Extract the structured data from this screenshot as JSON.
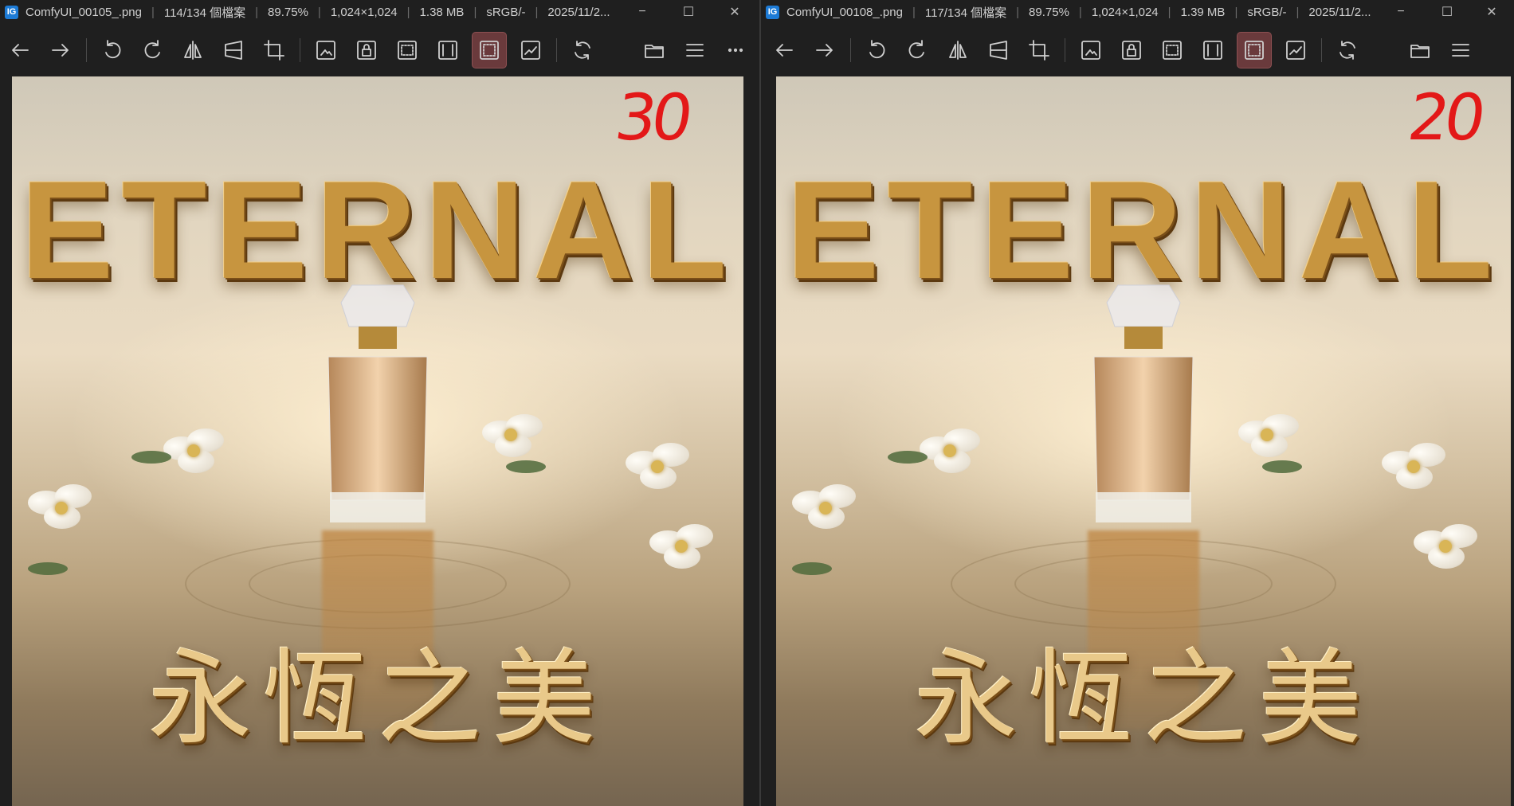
{
  "left": {
    "title": {
      "filename": "ComfyUI_00105_.png",
      "index": "114/134 個檔案",
      "zoom": "89.75%",
      "dimensions": "1,024×1,024",
      "filesize": "1.38 MB",
      "colorspace": "sRGB/-",
      "date": "2025/11/2..."
    },
    "image": {
      "badge": "30",
      "headline": "ETERNAL",
      "tagline": "永恆之美"
    }
  },
  "right": {
    "title": {
      "filename": "ComfyUI_00108_.png",
      "index": "117/134 個檔案",
      "zoom": "89.75%",
      "dimensions": "1,024×1,024",
      "filesize": "1.39 MB",
      "colorspace": "sRGB/-",
      "date": "2025/11/2..."
    },
    "image": {
      "badge": "20",
      "headline": "ETERNAL",
      "tagline": "永恆之美"
    }
  },
  "window_controls": {
    "minimize": "−",
    "maximize": "☐",
    "close": "✕"
  },
  "toolbar_icons": [
    "back-icon",
    "forward-icon",
    "rotate-left-icon",
    "rotate-right-icon",
    "flip-horizontal-icon",
    "perspective-icon",
    "crop-icon",
    "fit-image-icon",
    "lock-zoom-icon",
    "actual-size-icon",
    "fit-width-icon",
    "fit-window-icon",
    "histogram-icon",
    "refresh-icon",
    "open-folder-icon",
    "menu-icon",
    "more-icon"
  ],
  "colors": {
    "accent_active": "#6a3a3c",
    "badge_red": "#e31818",
    "gold": "#c7953f"
  }
}
